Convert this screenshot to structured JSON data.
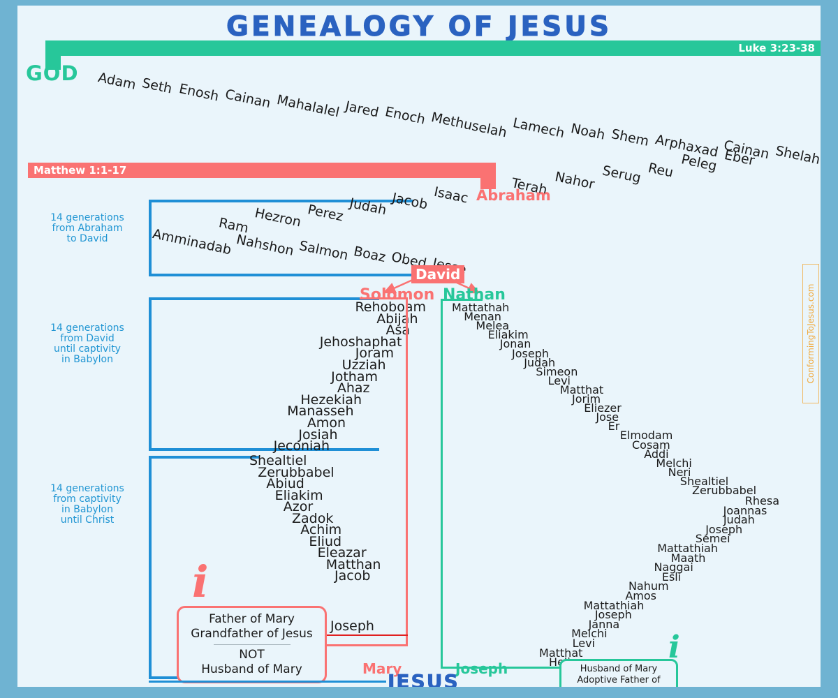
{
  "title": "Genealogy of Jesus",
  "colors": {
    "frame": "#6FB3D2",
    "canvas": "#EAF5FB",
    "title_blue": "#2A62C0",
    "luke_green": "#27C79A",
    "matthew_red": "#FA7272",
    "bracket_blue": "#1F8FD6",
    "label_blue": "#2196D3",
    "watermark_orange": "#F0A93C"
  },
  "banners": {
    "luke_label": "Luke 3:23-38",
    "matthew_label": "Matthew 1:1-17"
  },
  "god_label": "GOD",
  "generation_labels": [
    "14 generations\nfrom Abraham\nto David",
    "14 generations\nfrom David\nuntil captivity\nin Babylon",
    "14 generations\nfrom captivity\nin Babylon\nuntil Christ"
  ],
  "generation_labels_lines": [
    [
      "14 generations",
      "from Abraham",
      "to David"
    ],
    [
      "14 generations",
      "from David",
      "until captivity",
      "in Babylon"
    ],
    [
      "14 generations",
      "from captivity",
      "in Babylon",
      "until Christ"
    ]
  ],
  "luke_top_chain_down": [
    "Adam",
    "Seth",
    "Enosh",
    "Cainan",
    "Mahalalel",
    "Jared",
    "Enoch",
    "Methuselah",
    "Lamech",
    "Noah",
    "Shem",
    "Arphaxad",
    "Cainan",
    "Shelah"
  ],
  "luke_top_chain_back": [
    "Eber",
    "Peleg",
    "Reu",
    "Serug",
    "Nahor",
    "Terah"
  ],
  "abraham_label": "Abraham",
  "matthew_seg1_row1": [
    "Isaac",
    "Jacob",
    "Judah",
    "Perez",
    "Hezron",
    "Ram"
  ],
  "matthew_seg1_row2": [
    "Amminadab",
    "Nahshon",
    "Salmon",
    "Boaz",
    "Obed",
    "Jesse"
  ],
  "david_label": "David",
  "solomon_label": "Solomon",
  "nathan_label": "Nathan",
  "matthew_seg2": [
    "Rehoboam",
    "Abijah",
    "Asa",
    "Jehoshaphat",
    "Joram",
    "Uzziah",
    "Jotham",
    "Ahaz",
    "Hezekiah",
    "Manasseh",
    "Amon",
    "Josiah",
    "Jeconiah"
  ],
  "matthew_seg3": [
    "Shealtiel",
    "Zerubbabel",
    "Abiud",
    "Eliakim",
    "Azor",
    "Zadok",
    "Achim",
    "Eliud",
    "Eleazar",
    "Matthan",
    "Jacob"
  ],
  "matthew_joseph": "Joseph",
  "mary_label": "Mary",
  "mary_note": {
    "line1": "Father of Mary",
    "line2": "Grandfather of Jesus",
    "line3": "NOT",
    "line4": "Husband of Mary"
  },
  "luke_seg_a": [
    "Mattathah",
    "Menan",
    "Melea",
    "Eliakim",
    "Jonan",
    "Joseph",
    "Judah",
    "Simeon",
    "Levi",
    "Matthat",
    "Jorim",
    "Eliezer",
    "Jose",
    "Er",
    "Elmodam",
    "Cosam",
    "Addi",
    "Melchi",
    "Neri",
    "Shealtiel",
    "Zerubbabel"
  ],
  "luke_seg_b": [
    "Rhesa",
    "Joannas",
    "Judah",
    "Joseph",
    "Semei",
    "Mattathiah",
    "Maath",
    "Naggai",
    "Esli",
    "Nahum",
    "Amos",
    "Mattathiah",
    "Joseph",
    "Janna",
    "Melchi",
    "Levi",
    "Matthat",
    "Heli"
  ],
  "luke_joseph": "Joseph",
  "joseph_note": {
    "line1": "Husband of Mary",
    "line2": "Adoptive Father of Jesus"
  },
  "jesus_label": "JESUS",
  "watermark": "ConformingToJesus.com",
  "icons": {
    "info_red": "i",
    "info_green": "i"
  }
}
